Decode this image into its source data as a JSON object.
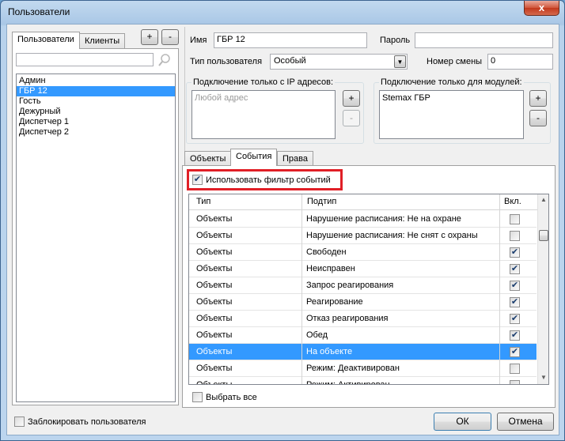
{
  "window": {
    "title": "Пользователи",
    "close_label": "x"
  },
  "left": {
    "tabs": [
      "Пользователи",
      "Клиенты"
    ],
    "add_label": "+",
    "remove_label": "-",
    "search_value": "",
    "users": [
      "Админ",
      "ГБР 12",
      "Гость",
      "Дежурный",
      "Диспетчер 1",
      "Диспетчер 2"
    ],
    "selected_user": "ГБР 12"
  },
  "form": {
    "name_label": "Имя",
    "name_value": "ГБР 12",
    "password_label": "Пароль",
    "password_value": "",
    "type_label": "Тип пользователя",
    "type_value": "Особый",
    "shift_label": "Номер смены",
    "shift_value": "0"
  },
  "ip_group": {
    "title": "Подключение только с IP адресов:",
    "placeholder": "Любой адрес",
    "add_label": "+",
    "remove_label": "-"
  },
  "module_group": {
    "title": "Подключение только для модулей:",
    "items": [
      "Stemax ГБР"
    ],
    "add_label": "+",
    "remove_label": "-"
  },
  "tabs": [
    "Объекты",
    "События",
    "Права"
  ],
  "active_tab": "События",
  "events": {
    "use_filter_label": "Использовать фильтр событий",
    "use_filter_checked": true,
    "columns": [
      "Тип",
      "Подтип",
      "Вкл."
    ],
    "rows": [
      {
        "type": "Объекты",
        "subtype": "Нарушение расписания: Не на охране",
        "on": false,
        "selected": false
      },
      {
        "type": "Объекты",
        "subtype": "Нарушение расписания: Не снят с охраны",
        "on": false,
        "selected": false
      },
      {
        "type": "Объекты",
        "subtype": "Свободен",
        "on": true,
        "selected": false
      },
      {
        "type": "Объекты",
        "subtype": "Неисправен",
        "on": true,
        "selected": false
      },
      {
        "type": "Объекты",
        "subtype": "Запрос реагирования",
        "on": true,
        "selected": false
      },
      {
        "type": "Объекты",
        "subtype": "Реагирование",
        "on": true,
        "selected": false
      },
      {
        "type": "Объекты",
        "subtype": "Отказ реагирования",
        "on": true,
        "selected": false
      },
      {
        "type": "Объекты",
        "subtype": "Обед",
        "on": true,
        "selected": false
      },
      {
        "type": "Объекты",
        "subtype": "На объекте",
        "on": true,
        "selected": true
      },
      {
        "type": "Объекты",
        "subtype": "Режим: Деактивирован",
        "on": false,
        "selected": false
      },
      {
        "type": "Объекты",
        "subtype": "Режим: Активирован",
        "on": false,
        "selected": false
      }
    ],
    "select_all_label": "Выбрать все"
  },
  "footer": {
    "block_label": "Заблокировать пользователя",
    "ok_label": "ОК",
    "cancel_label": "Отмена"
  },
  "colors": {
    "selection": "#3399ff",
    "highlight_box": "#e01f26"
  }
}
